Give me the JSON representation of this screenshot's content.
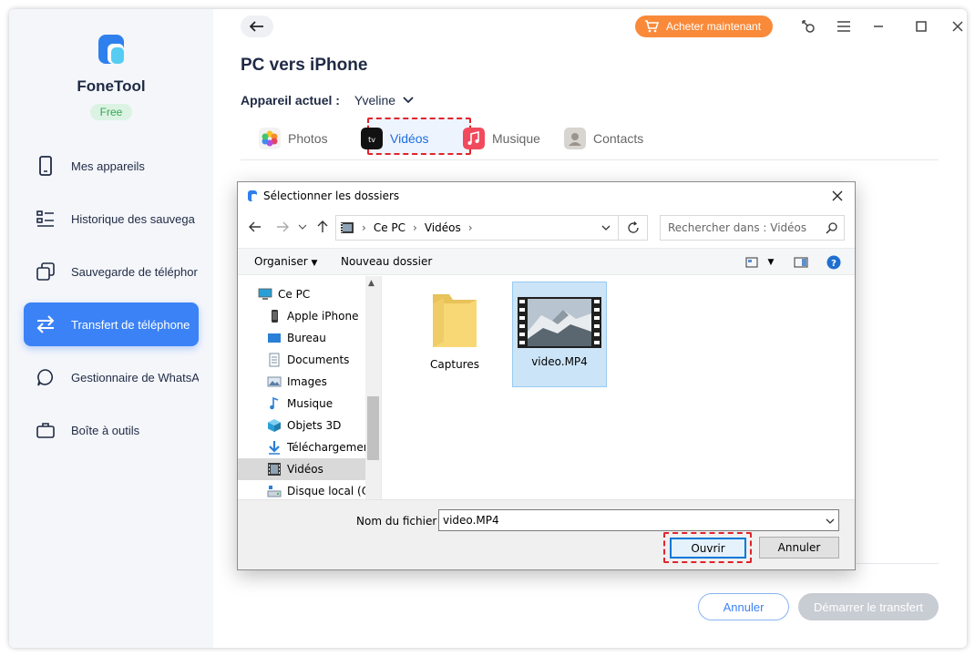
{
  "sidebar": {
    "brand": {
      "name": "FoneTool",
      "badge": "Free"
    },
    "items": [
      {
        "label": "Mes appareils",
        "icon": "phone-icon",
        "active": false
      },
      {
        "label": "Historique des sauvega",
        "icon": "list-icon",
        "active": false
      },
      {
        "label": "Sauvegarde de téléphor",
        "icon": "copy-icon",
        "active": false
      },
      {
        "label": "Transfert de téléphone",
        "icon": "transfer-icon",
        "active": true
      },
      {
        "label": "Gestionnaire de WhatsA",
        "icon": "chat-icon",
        "active": false
      },
      {
        "label": "Boîte à outils",
        "icon": "toolbox-icon",
        "active": false
      }
    ]
  },
  "header": {
    "buy_label": "Acheter maintenant"
  },
  "main": {
    "title": "PC vers iPhone",
    "device_label": "Appareil actuel :",
    "device_value": "Yveline",
    "tabs": [
      {
        "label": "Photos",
        "icon": "photos-icon",
        "active": false
      },
      {
        "label": "Vidéos",
        "icon": "appletv-icon",
        "active": true
      },
      {
        "label": "Musique",
        "icon": "music-icon",
        "active": false
      },
      {
        "label": "Contacts",
        "icon": "contacts-icon",
        "active": false
      }
    ],
    "cancel_label": "Annuler",
    "start_label": "Démarrer le transfert"
  },
  "dialog": {
    "title": "Sélectionner les dossiers",
    "breadcrumb": [
      "Ce PC",
      "Vidéos"
    ],
    "search_placeholder": "Rechercher dans : Vidéos",
    "organize_label": "Organiser",
    "new_folder_label": "Nouveau dossier",
    "tree": [
      {
        "label": "Ce PC",
        "level": 0
      },
      {
        "label": "Apple iPhone",
        "level": 1
      },
      {
        "label": "Bureau",
        "level": 1
      },
      {
        "label": "Documents",
        "level": 1
      },
      {
        "label": "Images",
        "level": 1
      },
      {
        "label": "Musique",
        "level": 1
      },
      {
        "label": "Objets 3D",
        "level": 1
      },
      {
        "label": "Téléchargements",
        "level": 1
      },
      {
        "label": "Vidéos",
        "level": 1,
        "selected": true
      },
      {
        "label": "Disque local (C:)",
        "level": 1
      }
    ],
    "files": [
      {
        "name": "Captures",
        "type": "folder"
      },
      {
        "name": "video.MP4",
        "type": "video",
        "selected": true
      }
    ],
    "filename_label": "Nom du fichier :",
    "filename_value": "video.MP4",
    "open_label": "Ouvrir",
    "cancel_label": "Annuler"
  },
  "colors": {
    "accent": "#3b82f6",
    "buy": "#f98a3a",
    "highlight": "#e0242b"
  }
}
